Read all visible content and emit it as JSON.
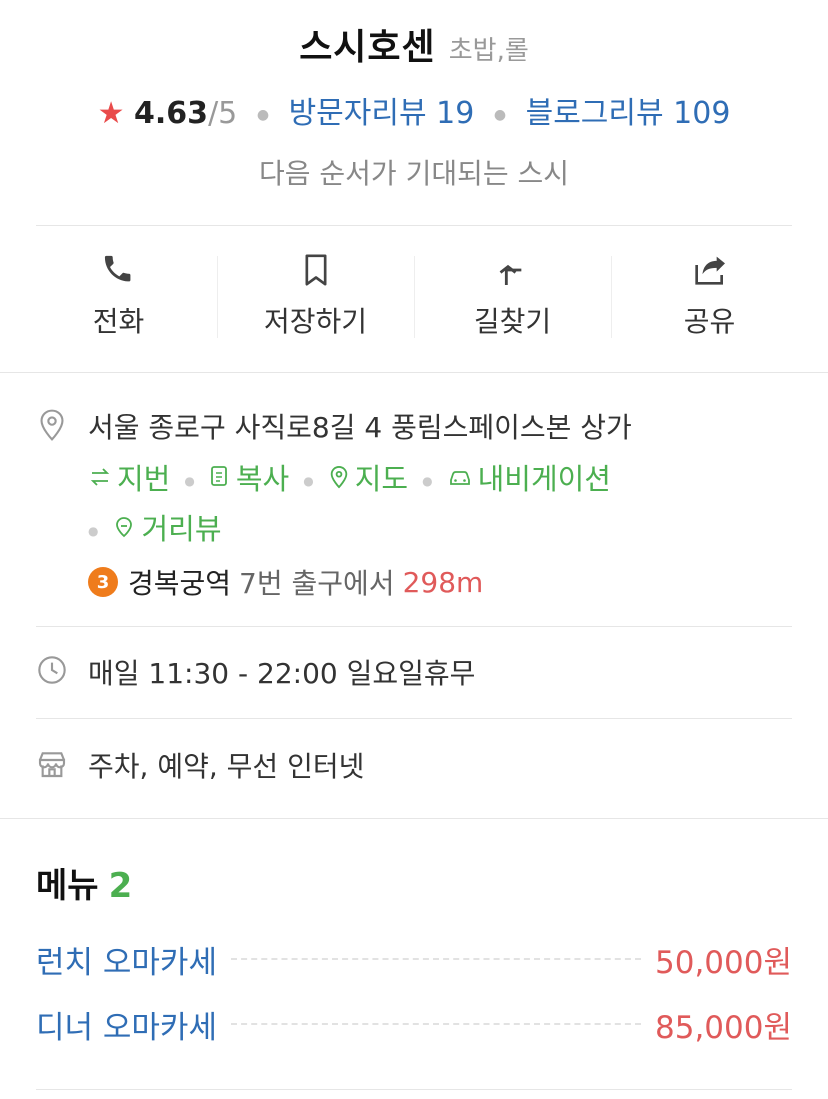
{
  "place": {
    "name": "스시호센",
    "category": "초밥,롤",
    "rating": "4.63",
    "rating_max": "/5",
    "visitor_reviews": "방문자리뷰 19",
    "blog_reviews": "블로그리뷰 109",
    "tagline": "다음 순서가 기대되는 스시"
  },
  "actions": {
    "call": "전화",
    "save": "저장하기",
    "directions": "길찾기",
    "share": "공유"
  },
  "address": {
    "text": "서울 종로구 사직로8길 4 풍림스페이스본 상가",
    "links": {
      "jibun": "지번",
      "copy": "복사",
      "map": "지도",
      "navigation": "내비게이션",
      "street_view": "거리뷰"
    },
    "subway": {
      "line": "3",
      "line_color": "#ef7c1c",
      "station": "경복궁역",
      "exit": "7번 출구에서",
      "distance": "298m"
    }
  },
  "hours": {
    "text": "매일 11:30 - 22:00 일요일휴무"
  },
  "amenities": {
    "text": "주차, 예약, 무선 인터넷"
  },
  "menu": {
    "title": "메뉴",
    "count": "2",
    "items": [
      {
        "name": "런치 오마카세",
        "price": "50,000원"
      },
      {
        "name": "디너 오마카세",
        "price": "85,000원"
      }
    ]
  },
  "colors": {
    "link_blue": "#2f6db5",
    "accent_green": "#4caf50",
    "price_red": "#e05a5a",
    "star_red": "#e94b4b"
  },
  "icons": {
    "star": "star-icon",
    "call": "phone-icon",
    "save": "bookmark-icon",
    "directions": "turn-arrow-icon",
    "share": "share-icon",
    "address": "location-pin-icon",
    "hours": "clock-icon",
    "amenities": "store-icon"
  }
}
